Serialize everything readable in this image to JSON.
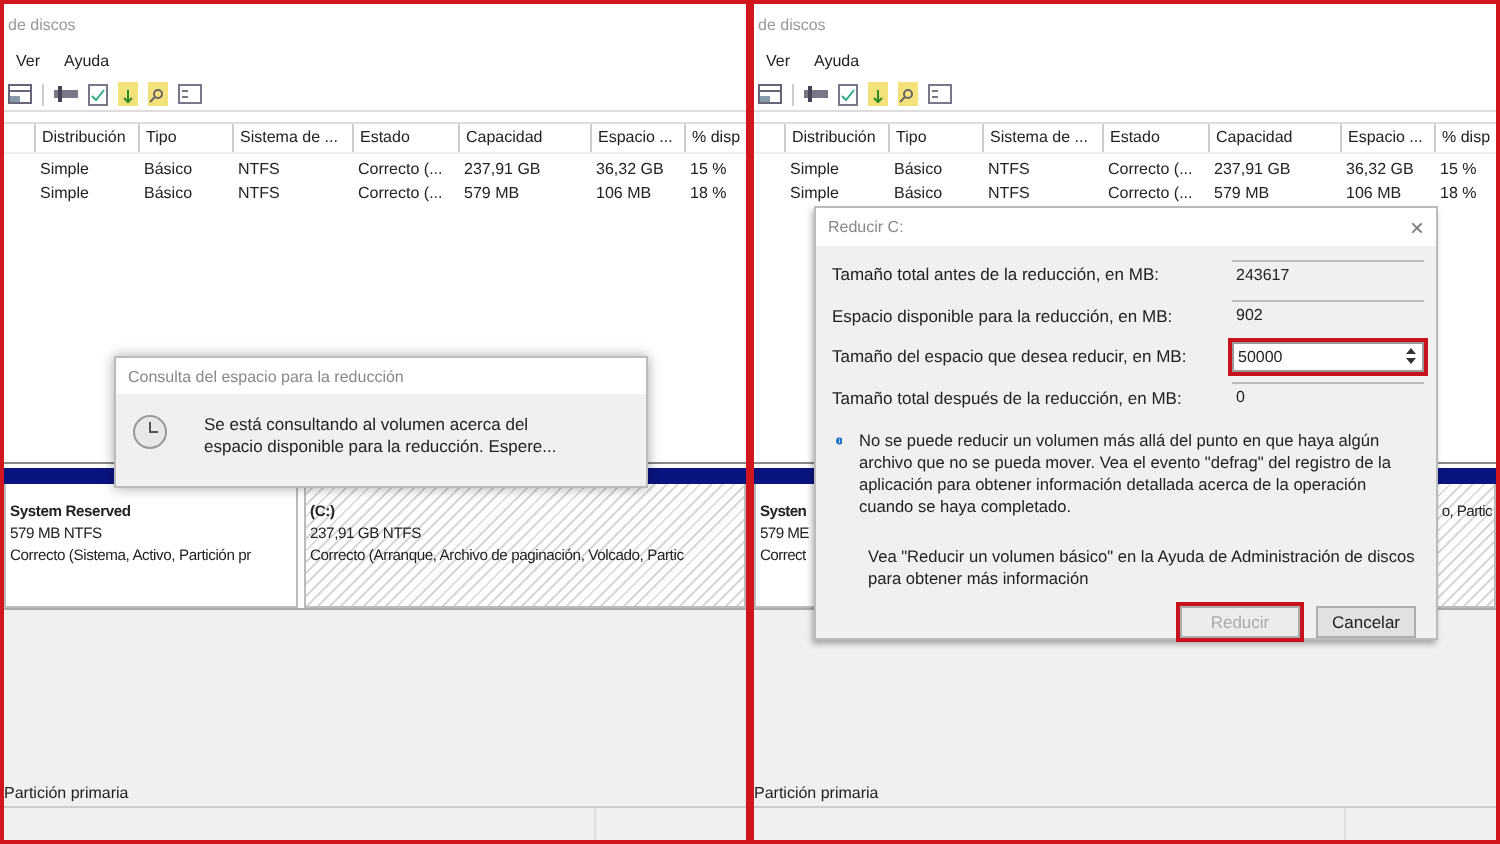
{
  "panels": [
    {
      "window": {
        "title": "de discos"
      },
      "menu": [
        "Ver",
        "Ayuda"
      ],
      "table": {
        "columns": [
          "Distribución",
          "Tipo",
          "Sistema de ...",
          "Estado",
          "Capacidad",
          "Espacio ...",
          "% disp"
        ],
        "rows": [
          [
            "Simple",
            "Básico",
            "NTFS",
            "Correcto (...",
            "237,91 GB",
            "36,32 GB",
            "15 %"
          ],
          [
            "Simple",
            "Básico",
            "NTFS",
            "Correcto (...",
            "579 MB",
            "106 MB",
            "18 %"
          ]
        ]
      },
      "partitions": [
        {
          "name": "System Reserved",
          "lines": [
            "579 MB NTFS",
            "Correcto (Sistema, Activo, Partición pr"
          ],
          "hatched": false,
          "clipped_left": false
        },
        {
          "name": "(C:)",
          "lines": [
            "237,91 GB NTFS",
            "Correcto (Arranque, Archivo de paginación, Volcado, Partic"
          ],
          "hatched": true,
          "clipped_left": false
        }
      ],
      "legend": "Partición primaria",
      "dialog": {
        "kind": "progress",
        "title": "Consulta del espacio para la reducción",
        "message": "Se está consultando al volumen acerca del espacio disponible para la reducción. Espere..."
      }
    },
    {
      "window": {
        "title": "de discos"
      },
      "menu": [
        "Ver",
        "Ayuda"
      ],
      "table": {
        "columns": [
          "Distribución",
          "Tipo",
          "Sistema de ...",
          "Estado",
          "Capacidad",
          "Espacio ...",
          "% disp"
        ],
        "rows": [
          [
            "Simple",
            "Básico",
            "NTFS",
            "Correcto (...",
            "237,91 GB",
            "36,32 GB",
            "15 %"
          ],
          [
            "Simple",
            "Básico",
            "NTFS",
            "Correcto (...",
            "579 MB",
            "106 MB",
            "18 %"
          ]
        ]
      },
      "partitions": [
        {
          "name": "Systen",
          "lines": [
            "579 ME",
            "Correct"
          ],
          "hatched": false,
          "clipped_left": false
        },
        {
          "lines": [
            "o, Partic"
          ],
          "hatched": true,
          "clipped_left": true
        }
      ],
      "legend": "Partición primaria",
      "dialog": {
        "kind": "shrink",
        "title": "Reducir C:",
        "close": "×",
        "fields": [
          {
            "label": "Tamaño total antes de la reducción, en MB:",
            "value": "243617",
            "editable": false,
            "highlighted": false
          },
          {
            "label": "Espacio disponible para la reducción, en MB:",
            "value": "902",
            "editable": false,
            "highlighted": false
          },
          {
            "label": "Tamaño del espacio que desea reducir, en MB:",
            "value": "50000",
            "editable": true,
            "highlighted": true
          },
          {
            "label": "Tamaño total después de la reducción, en MB:",
            "value": "0",
            "editable": false,
            "highlighted": false
          }
        ],
        "info": "No se puede reducir un volumen más allá del punto en que haya algún archivo que no se pueda mover. Vea el evento \"defrag\" del registro de la aplicación para obtener información detallada acerca de la operación cuando se haya completado.",
        "help": "Vea \"Reducir un volumen básico\"  en la Ayuda de Administración de discos para obtener más información",
        "buttons": [
          {
            "label": "Reducir",
            "disabled": true,
            "highlighted": true
          },
          {
            "label": "Cancelar",
            "disabled": false,
            "highlighted": false
          }
        ]
      }
    }
  ]
}
